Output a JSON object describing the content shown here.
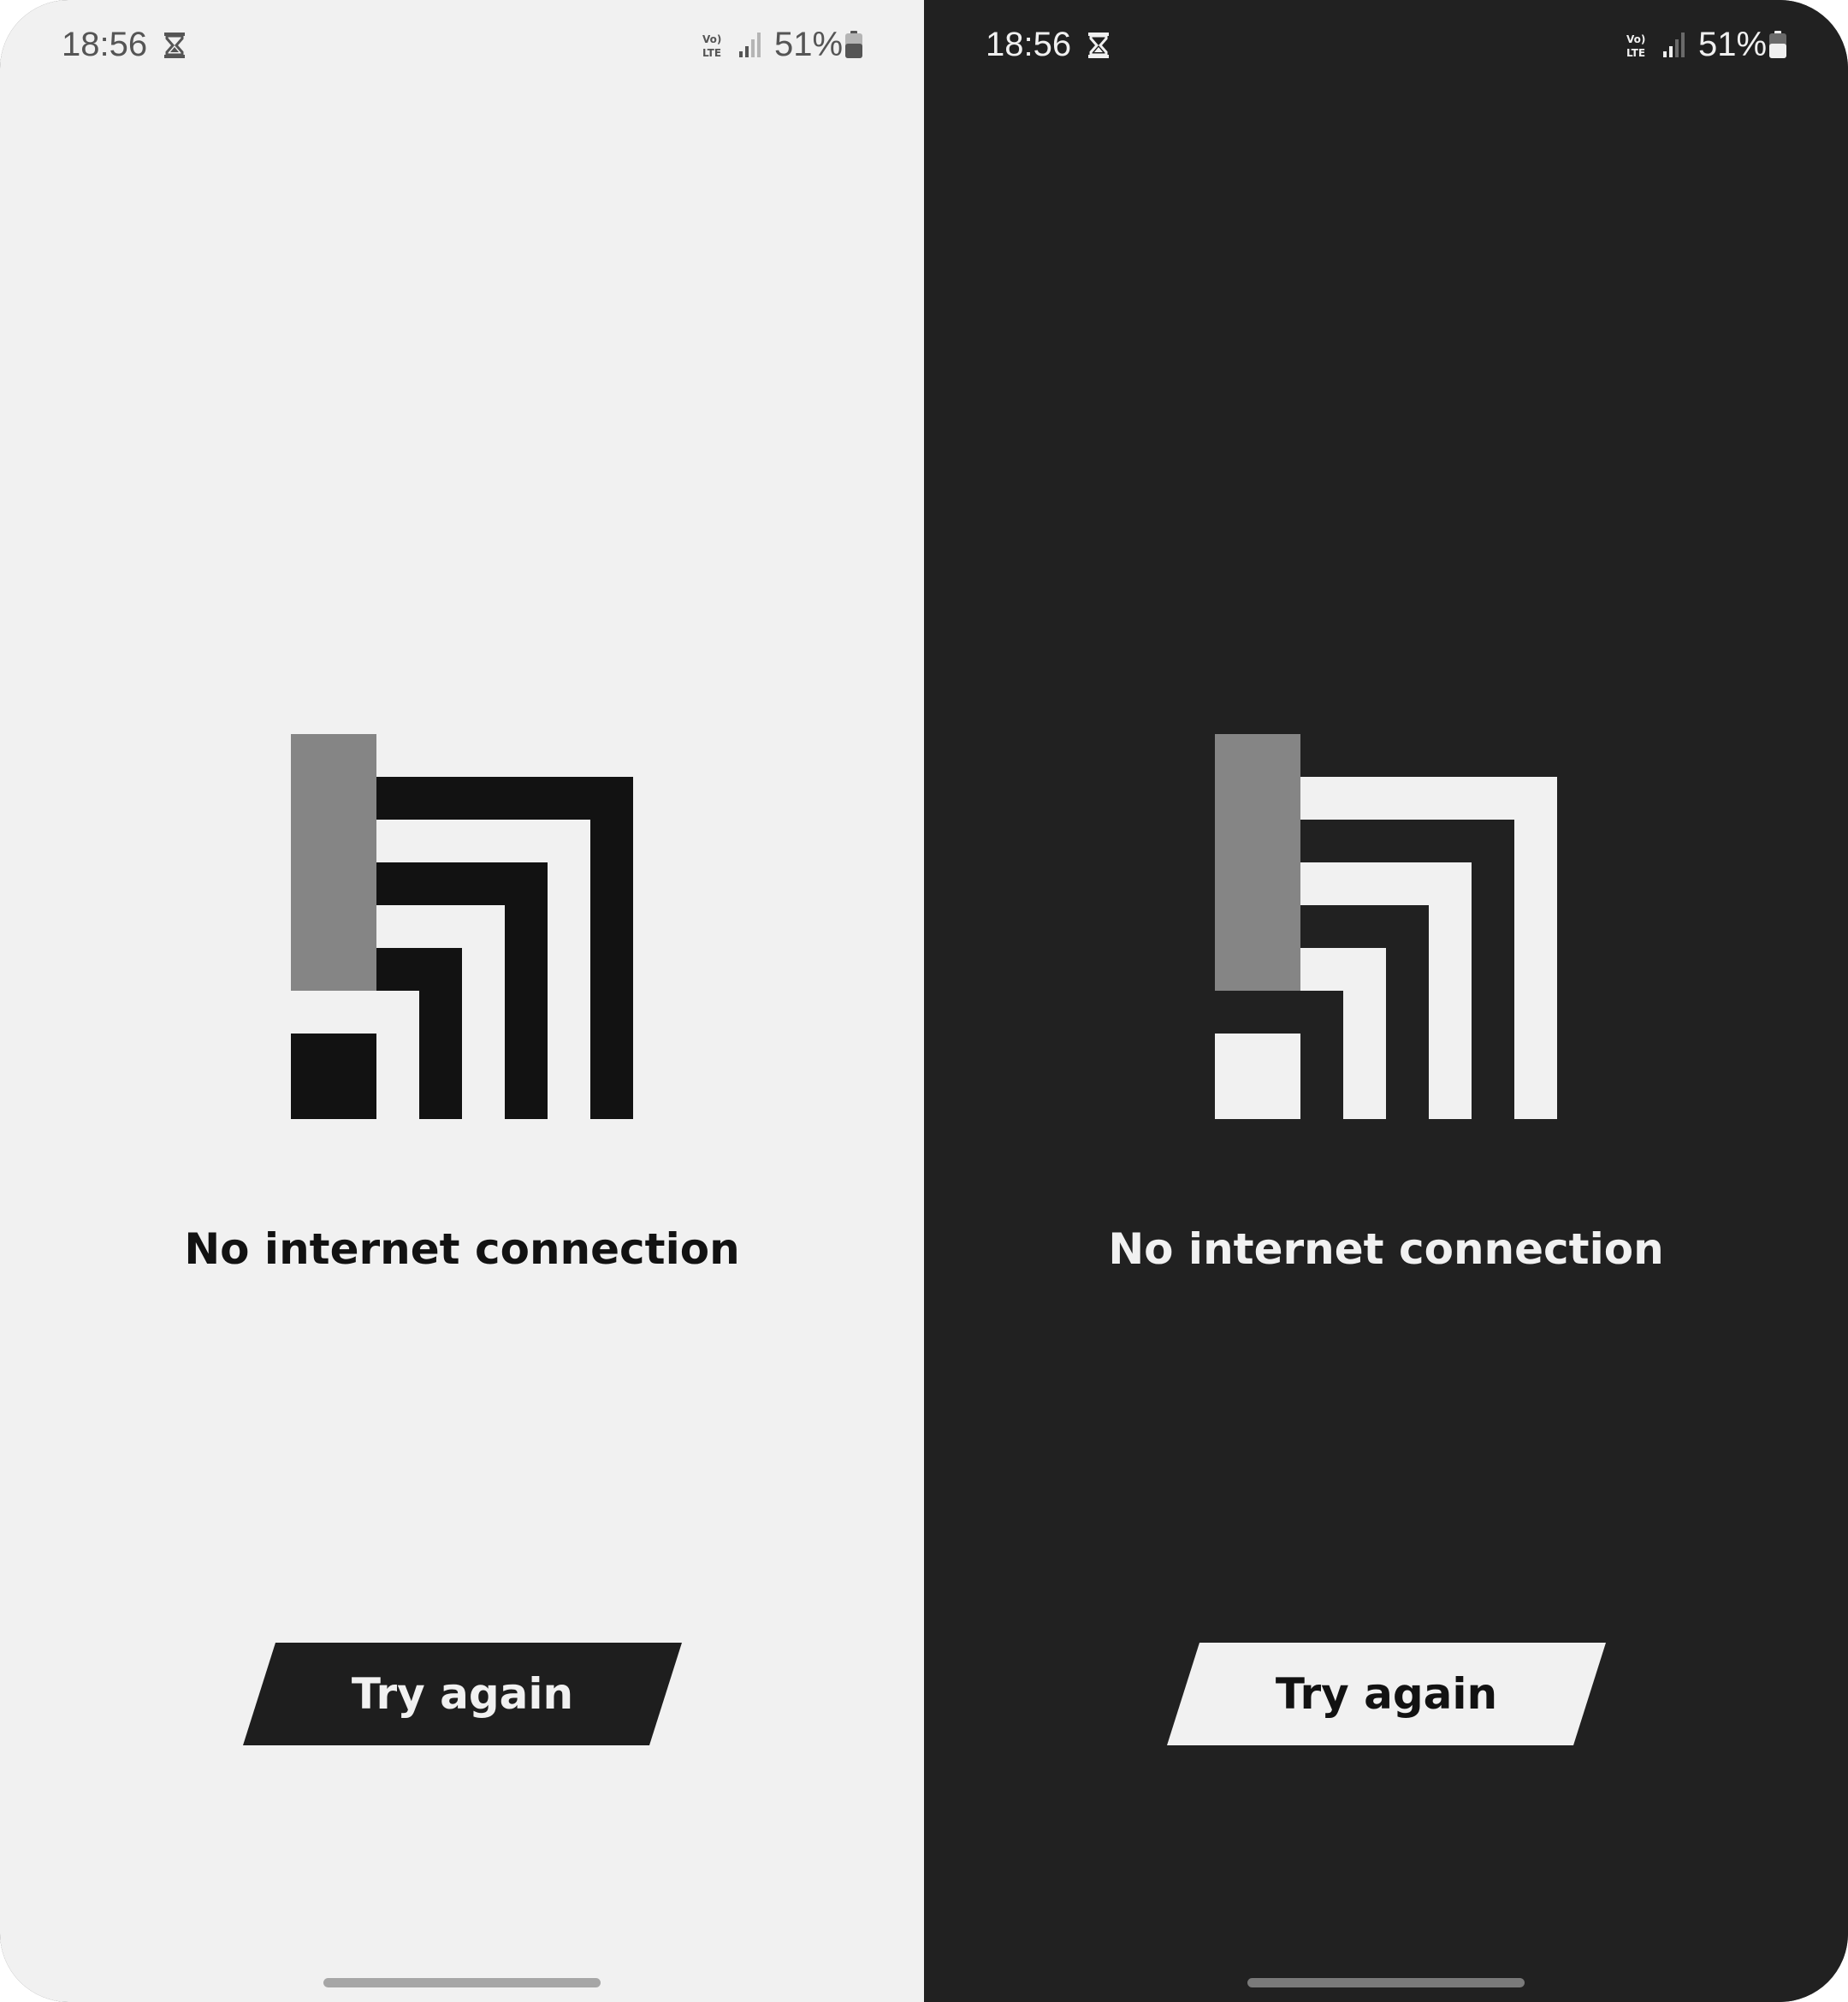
{
  "screens": [
    {
      "theme": "light",
      "status_bar": {
        "time": "18:56",
        "time_indicator_icon": "hourglass-icon",
        "network_icon": "volte-lte-icon",
        "signal_icon": "signal-strength-icon",
        "battery_percent": "51%",
        "battery_icon": "battery-icon",
        "battery_level": 0.51
      },
      "illustration_icon": "no-internet-icon",
      "headline": "No internet connection",
      "retry_button_label": "Try again",
      "colors": {
        "background": "#f1f1f1",
        "foreground": "#121212",
        "accent_gray": "#858585",
        "button_bg": "#1e1e1e",
        "button_text": "#f1f1f1"
      }
    },
    {
      "theme": "dark",
      "status_bar": {
        "time": "18:56",
        "time_indicator_icon": "hourglass-icon",
        "network_icon": "volte-lte-icon",
        "signal_icon": "signal-strength-icon",
        "battery_percent": "51%",
        "battery_icon": "battery-icon",
        "battery_level": 0.51
      },
      "illustration_icon": "no-internet-icon",
      "headline": "No internet connection",
      "retry_button_label": "Try again",
      "colors": {
        "background": "#212121",
        "foreground": "#f1f1f1",
        "accent_gray": "#858585",
        "button_bg": "#f1f1f1",
        "button_text": "#121212"
      }
    }
  ]
}
